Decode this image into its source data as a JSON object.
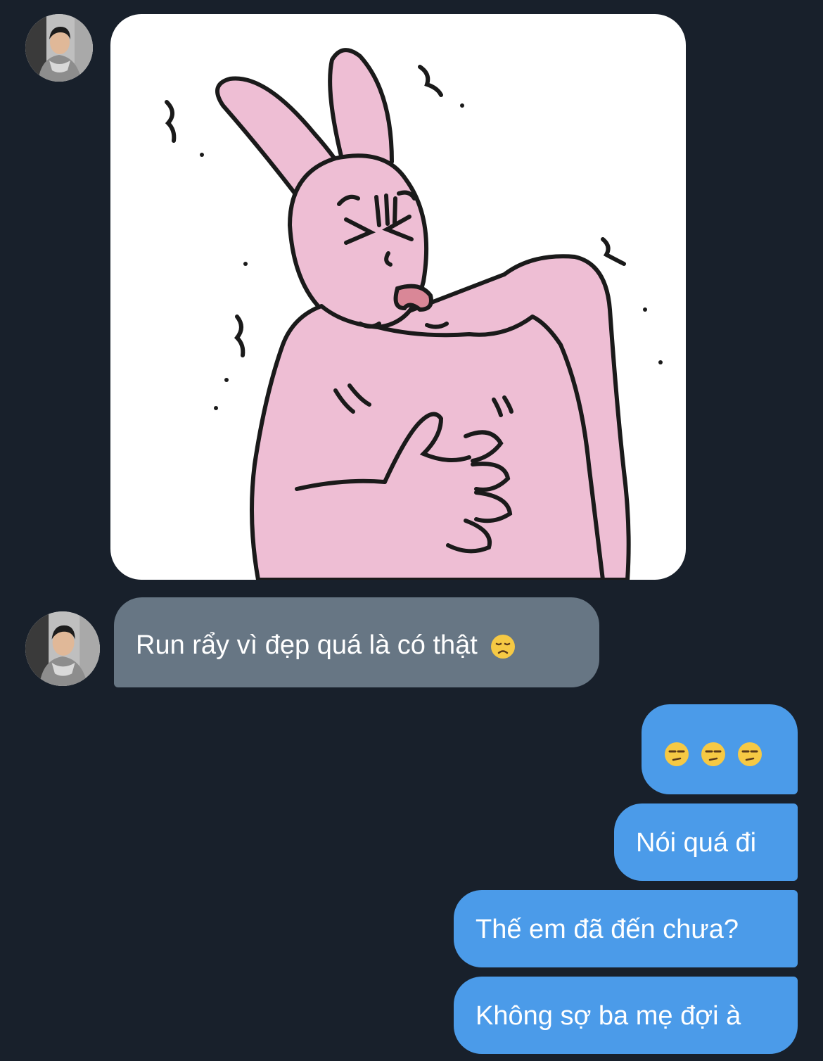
{
  "conversation": {
    "incoming": {
      "sticker": {
        "icon": "pink-rabbit-shivering-sticker"
      },
      "message": {
        "text": "Run rẩy vì đẹp quá là có thật",
        "emoji": "disappointed-face-emoji"
      }
    },
    "outgoing": [
      {
        "text": "",
        "emojis": [
          "unamused-face-emoji",
          "unamused-face-emoji",
          "unamused-face-emoji"
        ]
      },
      {
        "text": "Nói quá đi"
      },
      {
        "text": "Thế em đã đến chưa?"
      },
      {
        "text": "Không sợ ba mẹ đợi à"
      }
    ]
  },
  "colors": {
    "background": "#18202b",
    "incoming_bubble": "#677684",
    "outgoing_bubble": "#4b9be9",
    "rabbit_pink": "#eebed4"
  }
}
